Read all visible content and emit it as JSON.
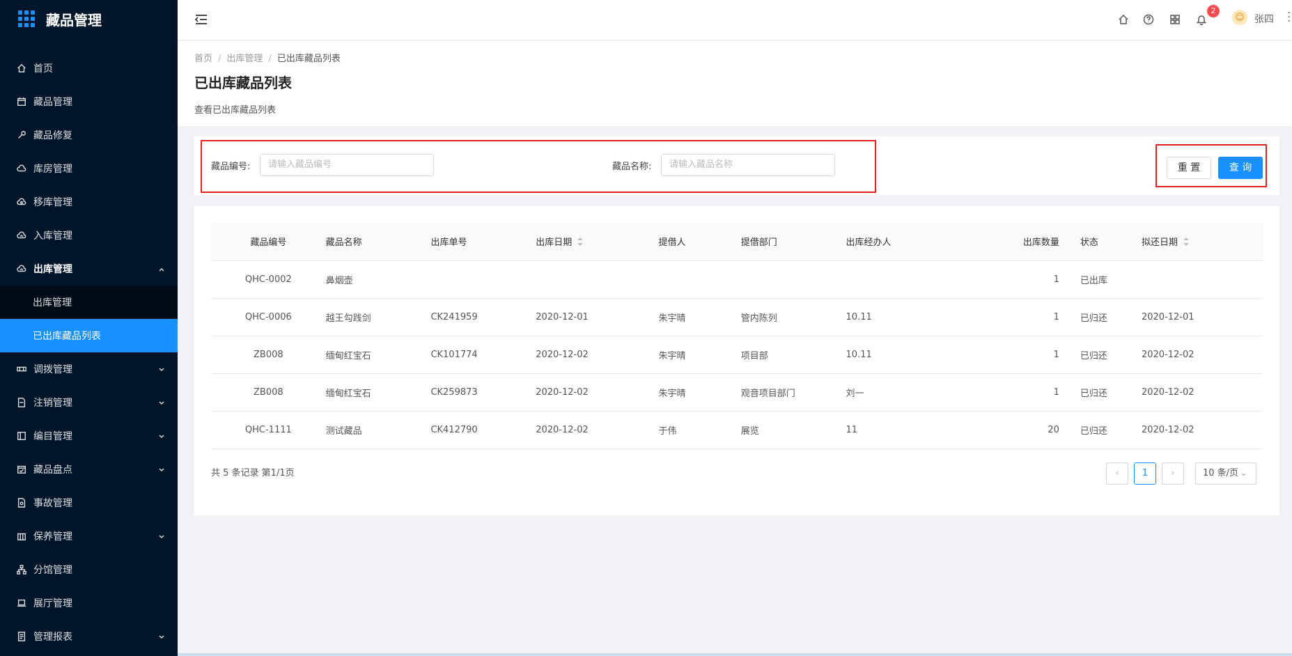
{
  "app": {
    "title": "藏品管理"
  },
  "sidebar": {
    "items": [
      {
        "label": "首页",
        "icon": "home-icon"
      },
      {
        "label": "藏品管理",
        "icon": "calendar-icon"
      },
      {
        "label": "藏品修复",
        "icon": "wrench-icon"
      },
      {
        "label": "库房管理",
        "icon": "cloud-icon"
      },
      {
        "label": "移库管理",
        "icon": "cloud-sync-icon"
      },
      {
        "label": "入库管理",
        "icon": "cloud-upload-icon"
      },
      {
        "label": "出库管理",
        "icon": "cloud-upload-icon"
      },
      {
        "label": "调拨管理",
        "icon": "exchange-icon"
      },
      {
        "label": "注销管理",
        "icon": "file-icon"
      },
      {
        "label": "编目管理",
        "icon": "book-icon"
      },
      {
        "label": "藏品盘点",
        "icon": "calendar-check-icon"
      },
      {
        "label": "事故管理",
        "icon": "file-search-icon"
      },
      {
        "label": "保养管理",
        "icon": "building-icon"
      },
      {
        "label": "分馆管理",
        "icon": "cluster-icon"
      },
      {
        "label": "展厅管理",
        "icon": "laptop-icon"
      },
      {
        "label": "管理报表",
        "icon": "report-icon"
      }
    ],
    "submenu": [
      {
        "label": "出库管理"
      },
      {
        "label": "已出库藏品列表"
      }
    ]
  },
  "header": {
    "notification_count": "2",
    "avatar_char": "☺",
    "username": "张四"
  },
  "breadcrumb": [
    "首页",
    "出库管理",
    "已出库藏品列表"
  ],
  "page": {
    "title": "已出库藏品列表",
    "description": "查看已出库藏品列表"
  },
  "search": {
    "code_label": "藏品编号:",
    "code_placeholder": "请输入藏品编号",
    "name_label": "藏品名称:",
    "name_placeholder": "请输入藏品名称",
    "reset_label": "重 置",
    "query_label": "查 询"
  },
  "table": {
    "columns": [
      "藏品编号",
      "藏品名称",
      "出库单号",
      "出库日期",
      "提借人",
      "提借部门",
      "出库经办人",
      "出库数量",
      "状态",
      "拟还日期"
    ],
    "rows": [
      [
        "QHC-0002",
        "鼻烟壶",
        "",
        "",
        "",
        "",
        "",
        "1",
        "已出库",
        ""
      ],
      [
        "QHC-0006",
        "越王勾践剑",
        "CK241959",
        "2020-12-01",
        "朱宇晴",
        "管内陈列",
        "10.11",
        "1",
        "已归还",
        "2020-12-01"
      ],
      [
        "ZB008",
        "缅甸红宝石",
        "CK101774",
        "2020-12-02",
        "朱宇晴",
        "项目部",
        "10.11",
        "1",
        "已归还",
        "2020-12-02"
      ],
      [
        "ZB008",
        "缅甸红宝石",
        "CK259873",
        "2020-12-02",
        "朱宇晴",
        "观音项目部门",
        "刘一",
        "1",
        "已归还",
        "2020-12-02"
      ],
      [
        "QHC-1111",
        "测试藏品",
        "CK412790",
        "2020-12-02",
        "于伟",
        "展览",
        "11",
        "20",
        "已归还",
        "2020-12-02"
      ]
    ]
  },
  "pagination": {
    "total_text": "共 5 条记录 第1/1页",
    "current_page": "1",
    "page_size": "10 条/页"
  }
}
